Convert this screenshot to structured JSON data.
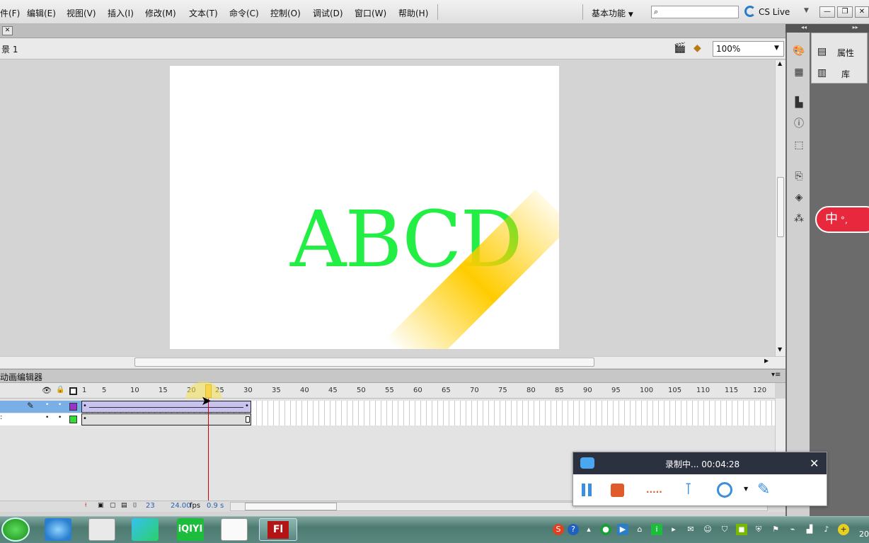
{
  "menubar": {
    "items": [
      "件(F)",
      "编辑(E)",
      "视图(V)",
      "插入(I)",
      "修改(M)",
      "文本(T)",
      "命令(C)",
      "控制(O)",
      "调试(D)",
      "窗口(W)",
      "帮助(H)"
    ],
    "workspace": "基本功能",
    "search_placeholder": "",
    "cs_live": "CS Live"
  },
  "scene": {
    "label": "景 1",
    "zoom": "100%"
  },
  "stage": {
    "text": "ABCD",
    "text_color": "#22ee44",
    "highlight_color": "#ffcc00"
  },
  "right_panel": {
    "properties": "属性",
    "library": "库"
  },
  "timeline": {
    "title": "动画编辑器",
    "ruler_ticks": [
      "1",
      "5",
      "10",
      "15",
      "20",
      "25",
      "30",
      "35",
      "40",
      "45",
      "50",
      "55",
      "60",
      "65",
      "70",
      "75",
      "80",
      "85",
      "90",
      "95",
      "100",
      "105",
      "110",
      "115",
      "120"
    ],
    "current_frame": "23",
    "fps": "24.00",
    "fps_unit": "fps",
    "time": "0.9 s",
    "layer1_color": "#9933cc",
    "layer2_color": "#33dd33"
  },
  "recorder": {
    "status": "录制中... 00:04:28"
  },
  "taskbar": {
    "app_label": "Fl",
    "clock": "20"
  }
}
